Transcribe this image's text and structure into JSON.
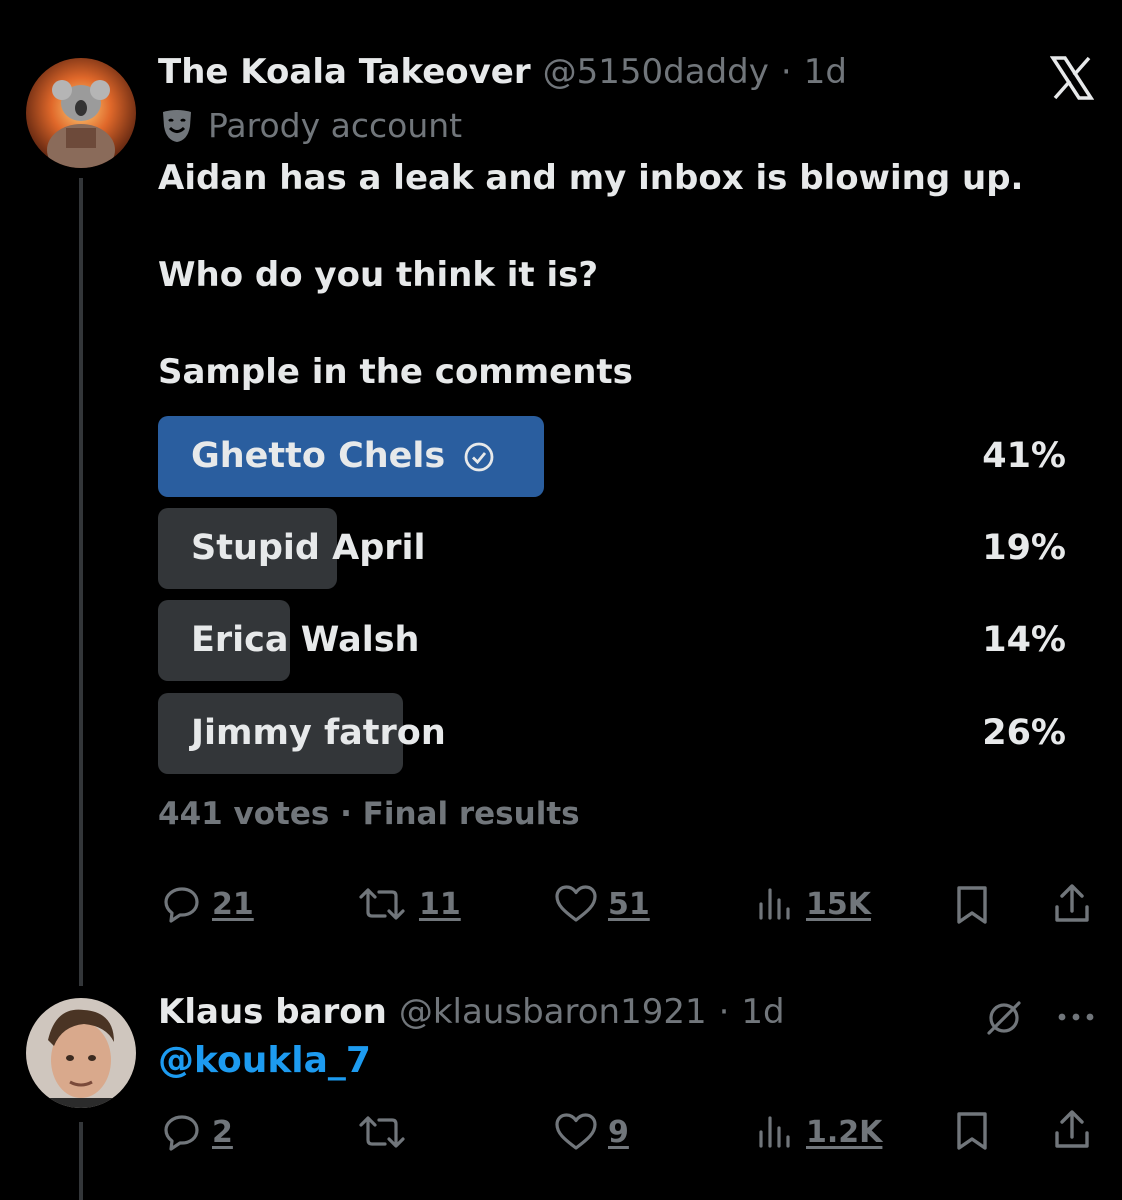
{
  "tweet": {
    "author_name": "The Koala Takeover",
    "handle": "@5150daddy",
    "sep": "·",
    "time": "1d",
    "parody_label": "Parody account",
    "text_line1": "Aidan has a leak and my inbox is blowing up.",
    "text_line2": "Who do you think it is?",
    "text_line3": "Sample in the comments",
    "poll": {
      "options": [
        {
          "label": "Ghetto Chels",
          "percent_text": "41%",
          "percent": 41,
          "winner": true
        },
        {
          "label": "Stupid April",
          "percent_text": "19%",
          "percent": 19,
          "winner": false
        },
        {
          "label": "Erica Walsh",
          "percent_text": "14%",
          "percent": 14,
          "winner": false
        },
        {
          "label": "Jimmy fatron",
          "percent_text": "26%",
          "percent": 26,
          "winner": false
        }
      ],
      "footer": "441 votes · Final results"
    },
    "actions": {
      "replies": "21",
      "reposts": "11",
      "likes": "51",
      "views": "15K"
    }
  },
  "reply": {
    "author_name": "Klaus baron",
    "handle": "@klausbaron1921",
    "sep": "·",
    "time": "1d",
    "mention": "@koukla_7",
    "actions": {
      "replies": "2",
      "likes": "9",
      "views": "1.2K"
    }
  },
  "colors": {
    "background": "#000000",
    "text": "#e7e9ea",
    "muted": "#71767b",
    "winner_bar": "#2a5e9f",
    "bar": "#333639",
    "link": "#1d9bf0"
  }
}
